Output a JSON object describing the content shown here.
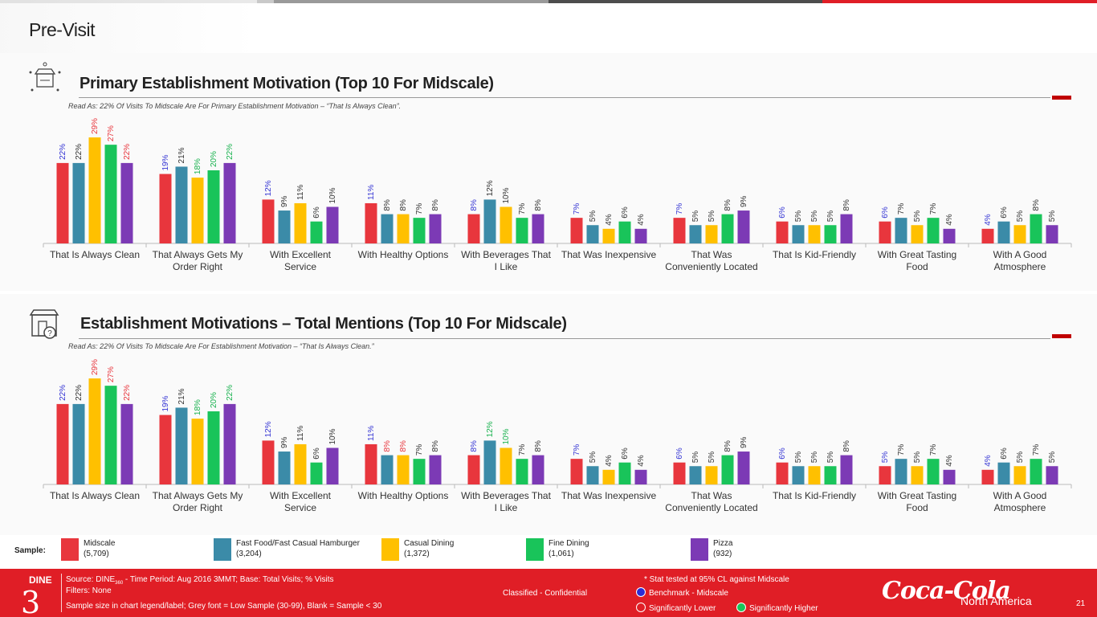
{
  "page": {
    "title": "Pre-Visit",
    "top_bar_colors": [
      "#c9c9c9",
      "#9a9a9a",
      "#4d4d4d",
      "#e01e26"
    ]
  },
  "colors": {
    "midscale": "#e8363d",
    "fast_food": "#3b8ba8",
    "casual": "#ffc000",
    "fine": "#19c45a",
    "pizza": "#7c3ab5",
    "label_default": "#333333",
    "label_blue": "#3535d4",
    "label_red": "#e8363d",
    "label_green": "#19b24f",
    "footer_red": "#e01e26"
  },
  "sections": [
    {
      "title": "Primary Establishment Motivation (Top 10 For Midscale)",
      "read_as": "Read As: 22% Of Visits To Midscale Are For Primary Establishment Motivation – “That Is Always Clean”.",
      "icon": "store-ideas-icon"
    },
    {
      "title": "Establishment Motivations – Total Mentions (Top 10 For Midscale)",
      "read_as": "Read As: 22% Of Visits To Midscale Are For Establishment Motivation – “That Is Always Clean.”",
      "icon": "store-question-icon"
    }
  ],
  "chart_data": [
    {
      "type": "bar",
      "categories": [
        "That Is Always Clean",
        "That Always Gets My Order Right",
        "With Excellent Service",
        "With Healthy Options",
        "With Beverages That I Like",
        "That Was Inexpensive",
        "That Was Conveniently Located",
        "That Is Kid-Friendly",
        "With Great Tasting Food",
        "With A Good Atmosphere"
      ],
      "series": [
        {
          "name": "Midscale",
          "color": "#e8363d",
          "values": [
            22,
            19,
            12,
            11,
            8,
            7,
            7,
            6,
            6,
            4
          ],
          "label_colors": [
            "blue",
            "blue",
            "blue",
            "blue",
            "blue",
            "blue",
            "blue",
            "blue",
            "blue",
            "blue"
          ]
        },
        {
          "name": "Fast Food/Fast Casual Hamburger",
          "color": "#3b8ba8",
          "values": [
            22,
            21,
            9,
            8,
            12,
            5,
            5,
            5,
            7,
            6
          ],
          "label_colors": [
            "default",
            "default",
            "default",
            "default",
            "default",
            "default",
            "default",
            "default",
            "default",
            "default"
          ]
        },
        {
          "name": "Casual Dining",
          "color": "#ffc000",
          "values": [
            29,
            18,
            11,
            8,
            10,
            4,
            5,
            5,
            5,
            5
          ],
          "label_colors": [
            "red",
            "green",
            "default",
            "default",
            "default",
            "default",
            "default",
            "default",
            "default",
            "default"
          ]
        },
        {
          "name": "Fine Dining",
          "color": "#19c45a",
          "values": [
            27,
            20,
            6,
            7,
            7,
            6,
            8,
            5,
            7,
            8
          ],
          "label_colors": [
            "red",
            "green",
            "default",
            "default",
            "default",
            "default",
            "default",
            "default",
            "default",
            "default"
          ]
        },
        {
          "name": "Pizza",
          "color": "#7c3ab5",
          "values": [
            22,
            22,
            10,
            8,
            8,
            4,
            9,
            8,
            4,
            5
          ],
          "label_colors": [
            "red",
            "green",
            "default",
            "default",
            "default",
            "default",
            "default",
            "default",
            "default",
            "default"
          ]
        }
      ],
      "ylim": [
        0,
        30
      ]
    },
    {
      "type": "bar",
      "categories": [
        "That Is Always Clean",
        "That Always Gets My Order Right",
        "With Excellent Service",
        "With Healthy Options",
        "With Beverages That I Like",
        "That Was Inexpensive",
        "That Was Conveniently Located",
        "That Is Kid-Friendly",
        "With Great Tasting Food",
        "With A Good Atmosphere"
      ],
      "series": [
        {
          "name": "Midscale",
          "color": "#e8363d",
          "values": [
            22,
            19,
            12,
            11,
            8,
            7,
            6,
            6,
            5,
            4
          ],
          "label_colors": [
            "blue",
            "blue",
            "blue",
            "blue",
            "blue",
            "blue",
            "blue",
            "blue",
            "blue",
            "blue"
          ]
        },
        {
          "name": "Fast Food/Fast Casual Hamburger",
          "color": "#3b8ba8",
          "values": [
            22,
            21,
            9,
            8,
            12,
            5,
            5,
            5,
            7,
            6
          ],
          "label_colors": [
            "default",
            "default",
            "default",
            "red",
            "green",
            "default",
            "default",
            "default",
            "default",
            "default"
          ]
        },
        {
          "name": "Casual Dining",
          "color": "#ffc000",
          "values": [
            29,
            18,
            11,
            8,
            10,
            4,
            5,
            5,
            5,
            5
          ],
          "label_colors": [
            "red",
            "green",
            "default",
            "red",
            "green",
            "default",
            "default",
            "default",
            "default",
            "default"
          ]
        },
        {
          "name": "Fine Dining",
          "color": "#19c45a",
          "values": [
            27,
            20,
            6,
            7,
            7,
            6,
            8,
            5,
            7,
            7
          ],
          "label_colors": [
            "red",
            "green",
            "default",
            "default",
            "default",
            "default",
            "default",
            "default",
            "default",
            "default"
          ]
        },
        {
          "name": "Pizza",
          "color": "#7c3ab5",
          "values": [
            22,
            22,
            10,
            8,
            8,
            4,
            9,
            8,
            4,
            5
          ],
          "label_colors": [
            "red",
            "green",
            "default",
            "default",
            "default",
            "default",
            "default",
            "default",
            "default",
            "default"
          ]
        }
      ],
      "ylim": [
        0,
        30
      ]
    }
  ],
  "legend": {
    "title": "Sample:",
    "items": [
      {
        "name": "Midscale",
        "sample": "(5,709)",
        "color": "#e8363d"
      },
      {
        "name": "Fast Food/Fast Casual Hamburger",
        "sample": "(3,204)",
        "color": "#3b8ba8"
      },
      {
        "name": "Casual Dining",
        "sample": "(1,372)",
        "color": "#ffc000"
      },
      {
        "name": "Fine Dining",
        "sample": "(1,061)",
        "color": "#19c45a"
      },
      {
        "name": "Pizza",
        "sample": "(932)",
        "color": "#7c3ab5"
      }
    ]
  },
  "footer": {
    "logo_word": "DINE",
    "logo_number": "3",
    "source_prefix": "Source: DINE",
    "source_sub": "360",
    "source_suffix": " - Time Period: Aug 2016 3MMT; Base: Total Visits; % Visits",
    "filters": "Filters: None",
    "sample_note": "Sample size in chart legend/label;  Grey font = Low Sample (30-99), Blank = Sample < 30",
    "classification": "Classified - Confidential",
    "stat_note": "* Stat tested at 95% CL against Midscale",
    "benchmark": "Benchmark - Midscale",
    "sig_lower": "Significantly Lower",
    "sig_higher": "Significantly Higher",
    "brand": "Coca-Cola",
    "region": "North America",
    "page_number": "21"
  }
}
